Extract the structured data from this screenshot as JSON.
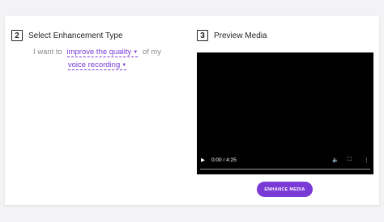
{
  "step2": {
    "number": "2",
    "title": "Select Enhancement Type"
  },
  "sentence": {
    "prefix": "I want to",
    "enhancement_dropdown": "improve the quality",
    "middle": "of my",
    "media_dropdown": "voice recording"
  },
  "step3": {
    "number": "3",
    "title": "Preview Media"
  },
  "video": {
    "time": "0:00 / 4:25",
    "progress": 0
  },
  "enhance_button": "ENHANCE MEDIA",
  "colors": {
    "accent": "#7a3ad6",
    "video_bg": "#000000"
  }
}
